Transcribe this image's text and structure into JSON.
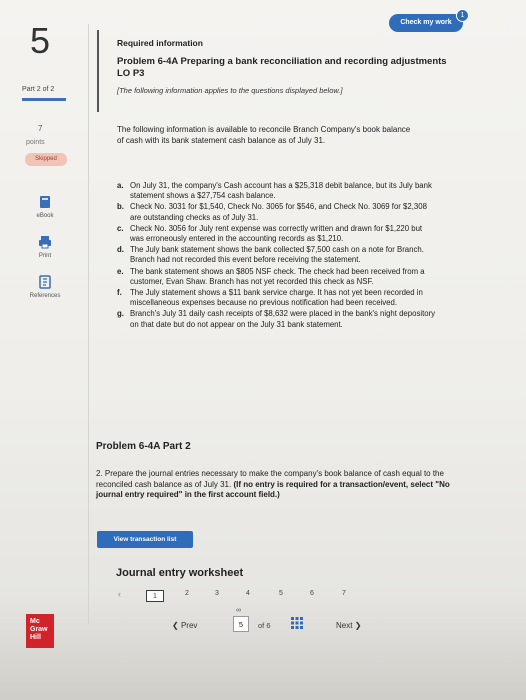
{
  "rail": {
    "question_number": "5",
    "part": "Part 2 of 2",
    "points_value": "7",
    "points_label": "points",
    "skipped_label": "Skipped",
    "tools": [
      {
        "label": "eBook",
        "icon": "book-icon"
      },
      {
        "label": "Print",
        "icon": "printer-icon"
      },
      {
        "label": "References",
        "icon": "references-icon"
      }
    ],
    "logo_text": [
      "Mc",
      "Graw",
      "Hill"
    ]
  },
  "header": {
    "check_button": "Check my work",
    "check_badge": "1"
  },
  "info": {
    "required": "Required information",
    "problem_title": "Problem 6-4A Preparing a bank reconciliation and recording adjustments LO P3",
    "applies_note": "[The following information applies to the questions displayed below.]"
  },
  "intro": "The following information is available to reconcile Branch Company's book balance of cash with its bank statement cash balance as of July 31.",
  "items": [
    {
      "marker": "a.",
      "text": "On July 31, the company's Cash account has a $25,318 debit balance, but its July bank statement shows a $27,754 cash balance."
    },
    {
      "marker": "b.",
      "text": "Check No. 3031 for $1,540, Check No. 3065 for $546, and Check No. 3069 for $2,308 are outstanding checks as of July 31."
    },
    {
      "marker": "c.",
      "text": "Check No. 3056 for July rent expense was correctly written and drawn for $1,220 but was erroneously entered in the accounting records as $1,210."
    },
    {
      "marker": "d.",
      "text": "The July bank statement shows the bank collected $7,500 cash on a note for Branch. Branch had not recorded this event before receiving the statement."
    },
    {
      "marker": "e.",
      "text": "The bank statement shows an $805 NSF check. The check had been received from a customer, Evan Shaw. Branch has not yet recorded this check as NSF."
    },
    {
      "marker": "f.",
      "text": "The July statement shows a $11 bank service charge. It has not yet been recorded in miscellaneous expenses because no previous notification had been received."
    },
    {
      "marker": "g.",
      "text": "Branch's July 31 daily cash receipts of $8,632 were placed in the bank's night depository on that date but do not appear on the July 31 bank statement."
    }
  ],
  "part2": {
    "title": "Problem 6-4A Part 2",
    "question_plain": "2. Prepare the journal entries necessary to make the company's book balance of cash equal to the reconciled cash balance as of July 31.",
    "question_bold": "(If no entry is required for a transaction/event, select \"No journal entry required\" in the first account field.)",
    "view_button": "View transaction list",
    "worksheet_title": "Journal entry worksheet",
    "worksheet_tabs": [
      "1",
      "2",
      "3",
      "4",
      "5",
      "6",
      "7"
    ]
  },
  "nav": {
    "prev_label": "Prev",
    "current_page": "5",
    "of_label": "of 6",
    "next_label": "Next"
  }
}
